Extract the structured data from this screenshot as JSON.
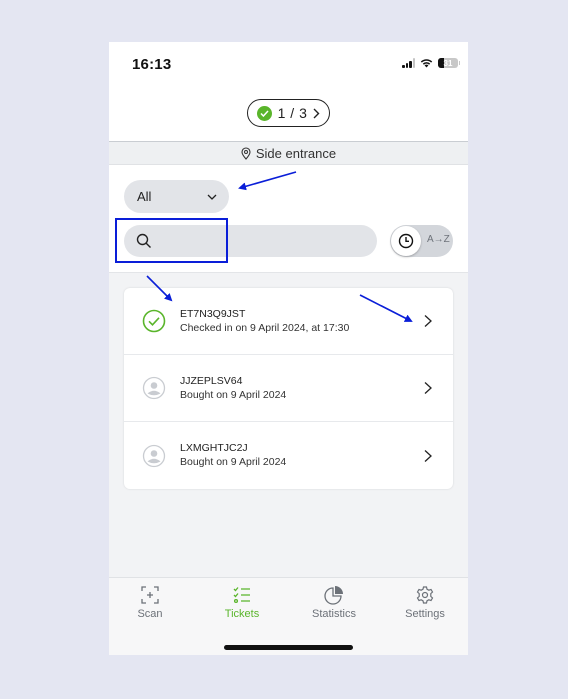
{
  "status_bar": {
    "time": "16:13",
    "battery_level": "31",
    "icons": [
      "signal-icon",
      "wifi-icon",
      "battery-icon"
    ]
  },
  "header": {
    "counter_text": "1 / 3",
    "counter_icon": "check-circle-icon"
  },
  "location": {
    "icon": "location-pin-icon",
    "label": "Side entrance"
  },
  "filter": {
    "selected": "All",
    "search_placeholder": "",
    "search_value": "",
    "sort_toggle": {
      "active": "time",
      "alt_label": "A→Z"
    }
  },
  "tickets": [
    {
      "id": "ET7N3Q9JST",
      "status": "checked-in",
      "subtitle": "Checked in on 9 April 2024, at 17:30"
    },
    {
      "id": "JJZEPLSV64",
      "status": "bought",
      "subtitle": "Bought on 9 April 2024"
    },
    {
      "id": "LXMGHTJC2J",
      "status": "bought",
      "subtitle": "Bought on 9 April 2024"
    }
  ],
  "tabs": [
    {
      "label": "Scan",
      "icon": "scan-icon",
      "active": false
    },
    {
      "label": "Tickets",
      "icon": "tickets-list-icon",
      "active": true
    },
    {
      "label": "Statistics",
      "icon": "pie-chart-icon",
      "active": false
    },
    {
      "label": "Settings",
      "icon": "gear-icon",
      "active": false
    }
  ],
  "colors": {
    "accent": "#5ab52b",
    "annotation": "#0a1ed8",
    "pill_bg": "#e2e4e8"
  }
}
